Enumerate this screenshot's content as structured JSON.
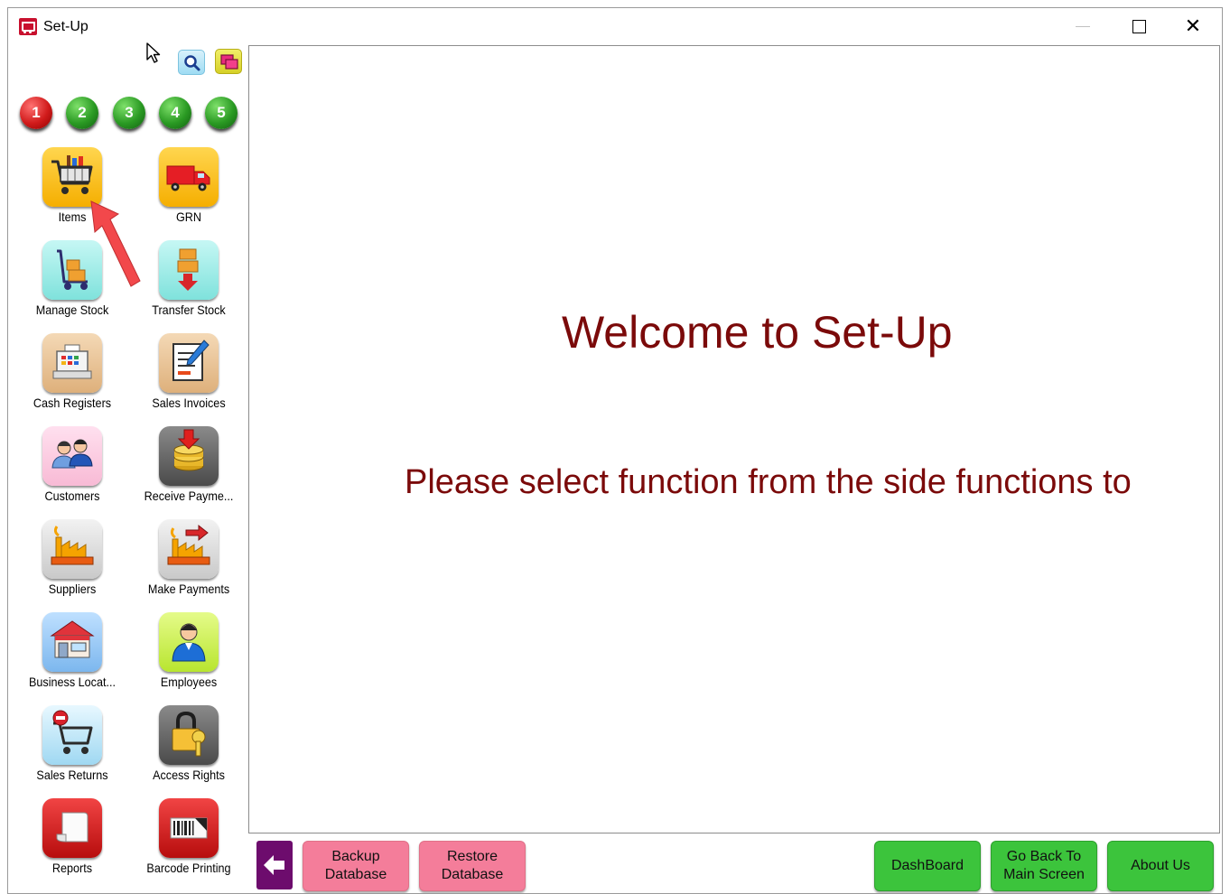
{
  "window": {
    "title": "Set-Up",
    "controls": {
      "minimize": "",
      "maximize": "",
      "close": "✕"
    }
  },
  "toolbar": {
    "search_icon": "magnifier",
    "windows_icon": "cascade-windows"
  },
  "pages": [
    "1",
    "2",
    "3",
    "4",
    "5"
  ],
  "active_page": "1",
  "tiles": [
    {
      "label": "Items",
      "icon": "shopping-cart",
      "color": "#f5ae00"
    },
    {
      "label": "GRN",
      "icon": "delivery-truck",
      "color": "#f5ae00"
    },
    {
      "label": "Manage Stock",
      "icon": "hand-trolley",
      "color": "#7fe2dc"
    },
    {
      "label": "Transfer Stock",
      "icon": "boxes-transfer",
      "color": "#7fe2dc"
    },
    {
      "label": "Cash Registers",
      "icon": "cash-register",
      "color": "#deb07b"
    },
    {
      "label": "Sales Invoices",
      "icon": "invoice-pen",
      "color": "#deb07b"
    },
    {
      "label": "Customers",
      "icon": "people",
      "color": "#f8bad5"
    },
    {
      "label": "Receive Payme...",
      "icon": "coins-down",
      "color": "#4a4a4a"
    },
    {
      "label": "Suppliers",
      "icon": "factory",
      "color": "#c9c9c9"
    },
    {
      "label": "Make Payments",
      "icon": "factory-arrow",
      "color": "#c9c9c9"
    },
    {
      "label": "Business Locat...",
      "icon": "store",
      "color": "#7cb7ee"
    },
    {
      "label": "Employees",
      "icon": "person",
      "color": "#b8e52f"
    },
    {
      "label": "Sales Returns",
      "icon": "cart-minus",
      "color": "#9fd8f2"
    },
    {
      "label": "Access Rights",
      "icon": "lock-key",
      "color": "#4a4a4a"
    },
    {
      "label": "Reports",
      "icon": "scroll",
      "color": "#b70d0d"
    },
    {
      "label": "Barcode Printing",
      "icon": "barcode",
      "color": "#b70d0d"
    }
  ],
  "main": {
    "welcome": "Welcome to Set-Up",
    "instruction": "Please select function from the side functions to"
  },
  "bottom": {
    "back_icon": "arrow-left",
    "backup": "Backup\nDatabase",
    "restore": "Restore\nDatabase",
    "dashboard": "DashBoard",
    "go_back": "Go Back To\nMain Screen",
    "about": "About Us"
  }
}
